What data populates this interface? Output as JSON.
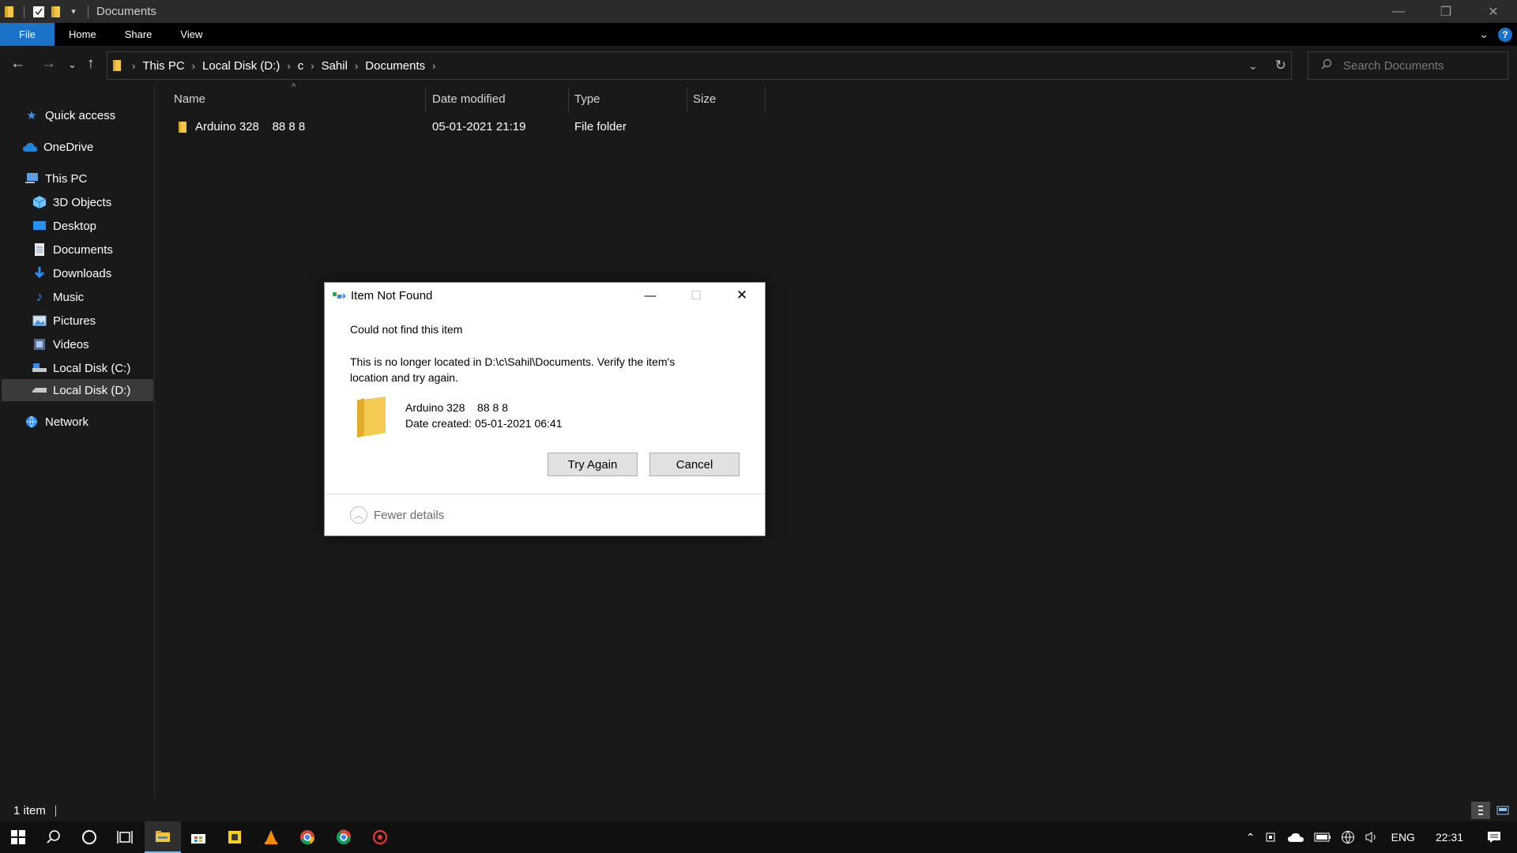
{
  "window": {
    "title": "Documents",
    "controls": {
      "minimize": "—",
      "restore": "❐",
      "close": "✕"
    }
  },
  "ribbon": {
    "tabs": [
      "File",
      "Home",
      "Share",
      "View"
    ],
    "help": "?"
  },
  "address": {
    "breadcrumbs": [
      "This PC",
      "Local Disk (D:)",
      "c",
      "Sahil",
      "Documents"
    ],
    "search_placeholder": "Search Documents"
  },
  "sidebar": {
    "items": [
      {
        "label": "Quick access",
        "icon": "star-icon"
      },
      {
        "label": "OneDrive",
        "icon": "cloud-icon"
      },
      {
        "label": "This PC",
        "icon": "computer-icon"
      },
      {
        "label": "3D Objects",
        "icon": "cube-icon"
      },
      {
        "label": "Desktop",
        "icon": "desktop-icon"
      },
      {
        "label": "Documents",
        "icon": "document-icon"
      },
      {
        "label": "Downloads",
        "icon": "download-icon"
      },
      {
        "label": "Music",
        "icon": "music-icon"
      },
      {
        "label": "Pictures",
        "icon": "pictures-icon"
      },
      {
        "label": "Videos",
        "icon": "videos-icon"
      },
      {
        "label": "Local Disk (C:)",
        "icon": "drive-icon"
      },
      {
        "label": "Local Disk (D:)",
        "icon": "drive-icon",
        "selected": true
      },
      {
        "label": "Network",
        "icon": "network-icon"
      }
    ]
  },
  "filelist": {
    "columns": [
      "Name",
      "Date modified",
      "Type",
      "Size"
    ],
    "rows": [
      {
        "name": "Arduino 328    88 8 8",
        "date_modified": "05-01-2021 21:19",
        "type": "File folder",
        "size": ""
      }
    ]
  },
  "status": {
    "count": "1 item"
  },
  "dialog": {
    "title": "Item Not Found",
    "heading": "Could not find this item",
    "message_line1": "This is no longer located in D:\\c\\Sahil\\Documents. Verify the item's",
    "message_line2": "location and try again.",
    "item_name": "Arduino 328    88 8 8",
    "item_created": "Date created: 05-01-2021 06:41",
    "try_again": "Try Again",
    "cancel": "Cancel",
    "fewer_details": "Fewer details"
  },
  "taskbar": {
    "tray": {
      "language": "ENG",
      "time": "22:31"
    }
  },
  "colors": {
    "accent": "#1a73c9",
    "folder": "#f3c644",
    "background": "#191919"
  }
}
